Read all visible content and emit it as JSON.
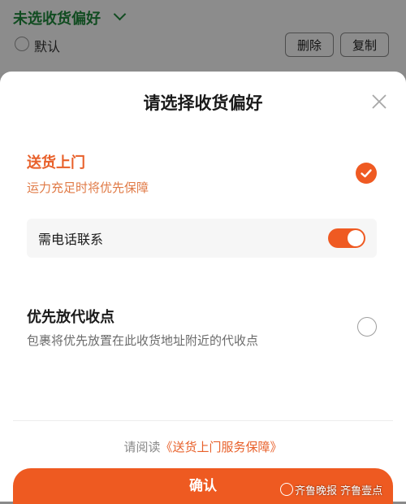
{
  "background_page": {
    "title": "未选收货偏好",
    "default_label": "默认",
    "delete_label": "删除",
    "copy_label": "复制"
  },
  "sheet": {
    "title": "请选择收货偏好",
    "option_door": {
      "title": "送货上门",
      "subtitle": "运力充足时将优先保障",
      "selected": true
    },
    "phone_contact": {
      "label": "需电话联系",
      "enabled": true
    },
    "option_pickup": {
      "title": "优先放代收点",
      "subtitle": "包裹将优先放置在此收货地址附近的代收点",
      "selected": false
    },
    "agreement": {
      "prefix": "请阅读",
      "link": "《送货上门服务保障》"
    },
    "confirm_label": "确认"
  },
  "watermark": {
    "text1": "齐鲁晚报",
    "text2": "齐鲁壹点"
  },
  "colors": {
    "accent": "#ef5a22",
    "green_title": "#1f8a3c"
  }
}
